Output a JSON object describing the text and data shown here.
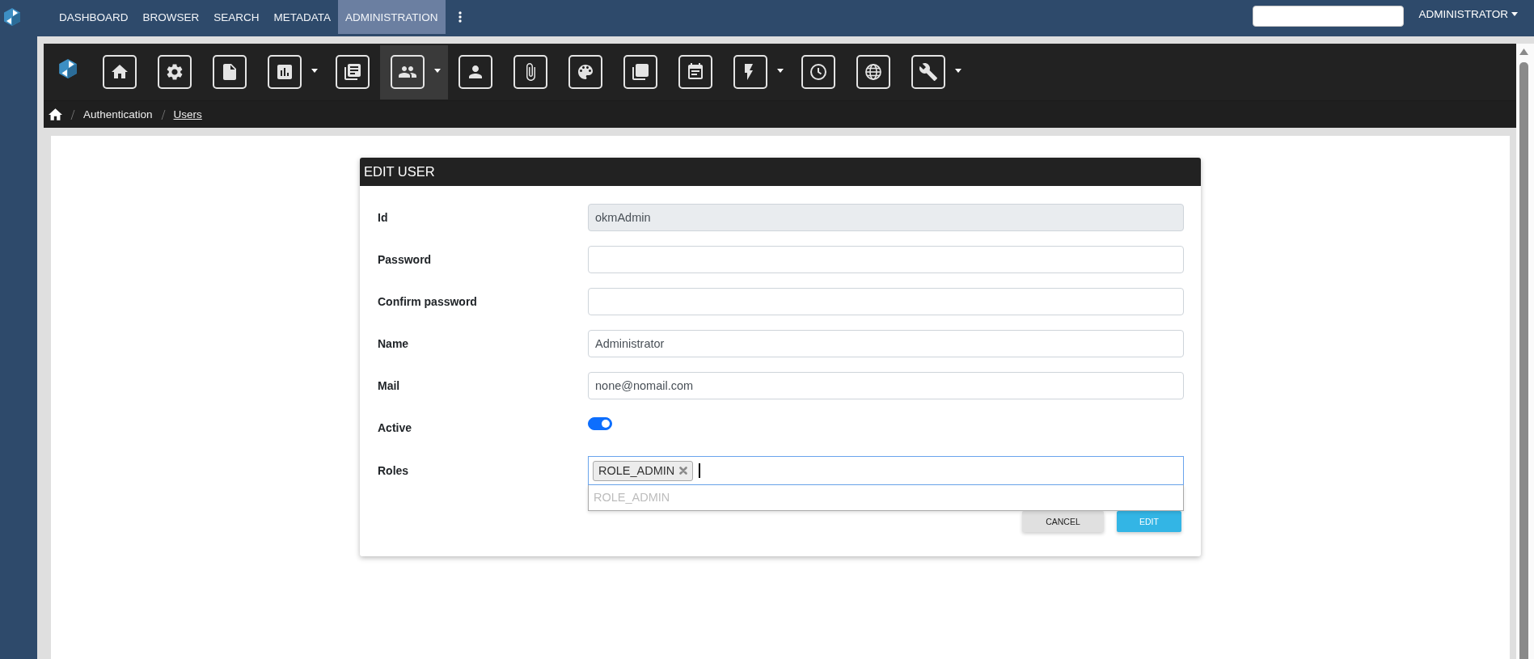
{
  "top_nav": {
    "items": [
      {
        "label": "DASHBOARD",
        "selected": false
      },
      {
        "label": "BROWSER",
        "selected": false
      },
      {
        "label": "SEARCH",
        "selected": false
      },
      {
        "label": "METADATA",
        "selected": false
      },
      {
        "label": "ADMINISTRATION",
        "selected": true
      }
    ],
    "user_menu": "ADMINISTRATOR"
  },
  "toolbar": {
    "buttons": [
      {
        "selected": false,
        "dropdown": false
      },
      {
        "selected": false,
        "dropdown": false
      },
      {
        "selected": false,
        "dropdown": false
      },
      {
        "selected": false,
        "dropdown": true
      },
      {
        "selected": false,
        "dropdown": false
      },
      {
        "selected": true,
        "dropdown": true
      },
      {
        "selected": false,
        "dropdown": false
      },
      {
        "selected": false,
        "dropdown": false
      },
      {
        "selected": false,
        "dropdown": false
      },
      {
        "selected": false,
        "dropdown": false
      },
      {
        "selected": false,
        "dropdown": false
      },
      {
        "selected": false,
        "dropdown": true
      },
      {
        "selected": false,
        "dropdown": false
      },
      {
        "selected": false,
        "dropdown": false
      },
      {
        "selected": false,
        "dropdown": true
      }
    ]
  },
  "breadcrumb": [
    {
      "label": "Authentication",
      "link": false
    },
    {
      "label": "Users",
      "link": true
    }
  ],
  "dialog": {
    "title": "EDIT USER",
    "fields": [
      {
        "kind": "text",
        "label": "Id",
        "value": "okmAdmin",
        "disabled": true
      },
      {
        "kind": "text",
        "label": "Password",
        "disabled": false
      },
      {
        "kind": "text",
        "label": "Confirm password",
        "disabled": false
      },
      {
        "kind": "text",
        "label": "Name",
        "value": "Administrator",
        "disabled": false
      },
      {
        "kind": "text",
        "label": "Mail",
        "value": "none@nomail.com",
        "disabled": false
      },
      {
        "kind": "toggle",
        "label": "Active",
        "on": true
      },
      {
        "kind": "tags",
        "label": "Roles",
        "tags": [
          "ROLE_ADMIN"
        ],
        "focused": true,
        "suggestions": [
          "ROLE_ADMIN"
        ]
      }
    ],
    "buttons": [
      {
        "label": "CANCEL",
        "kind": "secondary"
      },
      {
        "label": "EDIT",
        "kind": "primary"
      }
    ]
  }
}
